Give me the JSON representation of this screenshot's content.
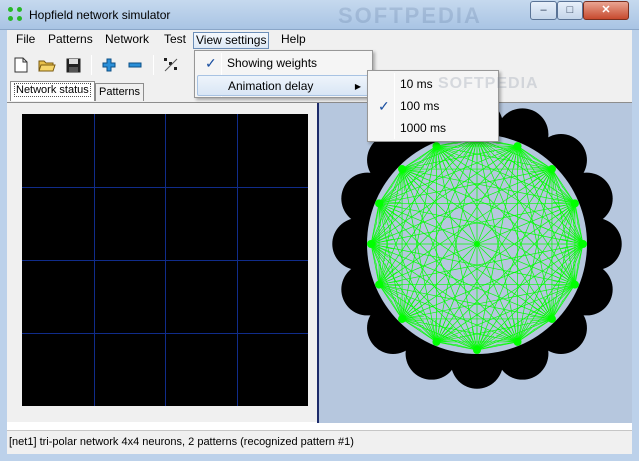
{
  "window": {
    "title": "Hopfield network simulator",
    "watermark": "SOFTPEDIA",
    "controls": {
      "minimize": "–",
      "maximize": "□",
      "close": "✕"
    }
  },
  "menubar": {
    "items": [
      {
        "label": "File"
      },
      {
        "label": "Patterns"
      },
      {
        "label": "Network"
      },
      {
        "label": "Test"
      },
      {
        "label": "View settings"
      },
      {
        "label": "Help"
      }
    ],
    "active_index": 4
  },
  "toolbar": {
    "icons": [
      "new-file-icon",
      "open-folder-icon",
      "save-icon",
      "add-icon",
      "remove-icon",
      "random-pattern-icon"
    ]
  },
  "tabs": [
    {
      "label": "Network status",
      "selected": true
    },
    {
      "label": "Patterns",
      "selected": false
    }
  ],
  "view_settings_menu": {
    "items": [
      {
        "label": "Showing weights",
        "checked": true,
        "has_submenu": false
      },
      {
        "label": "Animation delay",
        "checked": false,
        "has_submenu": true
      }
    ],
    "submenu_arrow": "▶",
    "check_glyph": "✓"
  },
  "animation_delay_submenu": {
    "watermark": "SOFTPEDIA",
    "items": [
      {
        "label": "10 ms",
        "checked": false
      },
      {
        "label": "100 ms",
        "checked": true
      },
      {
        "label": "1000 ms",
        "checked": false
      }
    ]
  },
  "network": {
    "grid_rows": 4,
    "grid_cols": 4,
    "neuron_count": 16,
    "colors": {
      "grid_background": "#000000",
      "grid_lines": "#102c8a",
      "panel_background": "#b6c7de",
      "weights": "#00ff00",
      "neuron_shadow": "#000000"
    }
  },
  "statusbar": {
    "text": "[net1] tri-polar network 4x4 neurons, 2 patterns (recognized pattern #1)"
  }
}
